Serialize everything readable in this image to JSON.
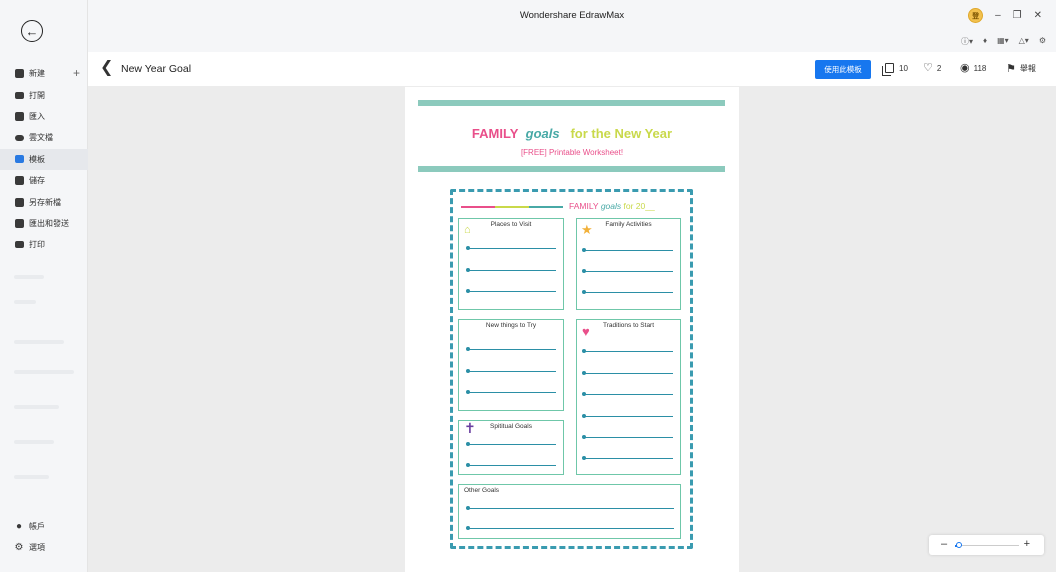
{
  "app": {
    "title": "Wondershare EdrawMax"
  },
  "sidebar": {
    "items": [
      {
        "label": "新建",
        "icon": "plus-square-icon"
      },
      {
        "label": "打開",
        "icon": "folder-icon"
      },
      {
        "label": "匯入",
        "icon": "import-icon"
      },
      {
        "label": "雲文檔",
        "icon": "cloud-icon"
      },
      {
        "label": "模板",
        "icon": "template-icon"
      },
      {
        "label": "儲存",
        "icon": "save-icon"
      },
      {
        "label": "另存新檔",
        "icon": "save-as-icon"
      },
      {
        "label": "匯出和發送",
        "icon": "export-icon"
      },
      {
        "label": "打印",
        "icon": "print-icon"
      }
    ],
    "account_label": "帳戶",
    "options_label": "選項"
  },
  "titlebar": {
    "avatar_text": "登"
  },
  "template": {
    "title": "New Year Goal",
    "use_button": "使用此模板",
    "copies": "10",
    "likes": "2",
    "views": "118",
    "report": "舉報"
  },
  "poster": {
    "title_family": "FAMILY",
    "title_goals": "goals",
    "title_rest": "for the New Year",
    "subtitle": "[FREE] Printable Worksheet!",
    "inner_family": "FAMILY",
    "inner_goals": "goals",
    "inner_for": "for 20__",
    "boxes": {
      "places": "Places to Visit",
      "activities": "Family Activities",
      "new_things": "New things to Try",
      "traditions": "Traditions to Start",
      "spiritual": "Spititual Goals",
      "other": "Other Goals"
    }
  },
  "colors": {
    "accent_blue": "#1777ef",
    "pink": "#e94f8a",
    "teal": "#48a9a6",
    "lime": "#c9d94a",
    "frame": "#3a9bb0"
  },
  "zoom": {
    "level": 0.06
  }
}
